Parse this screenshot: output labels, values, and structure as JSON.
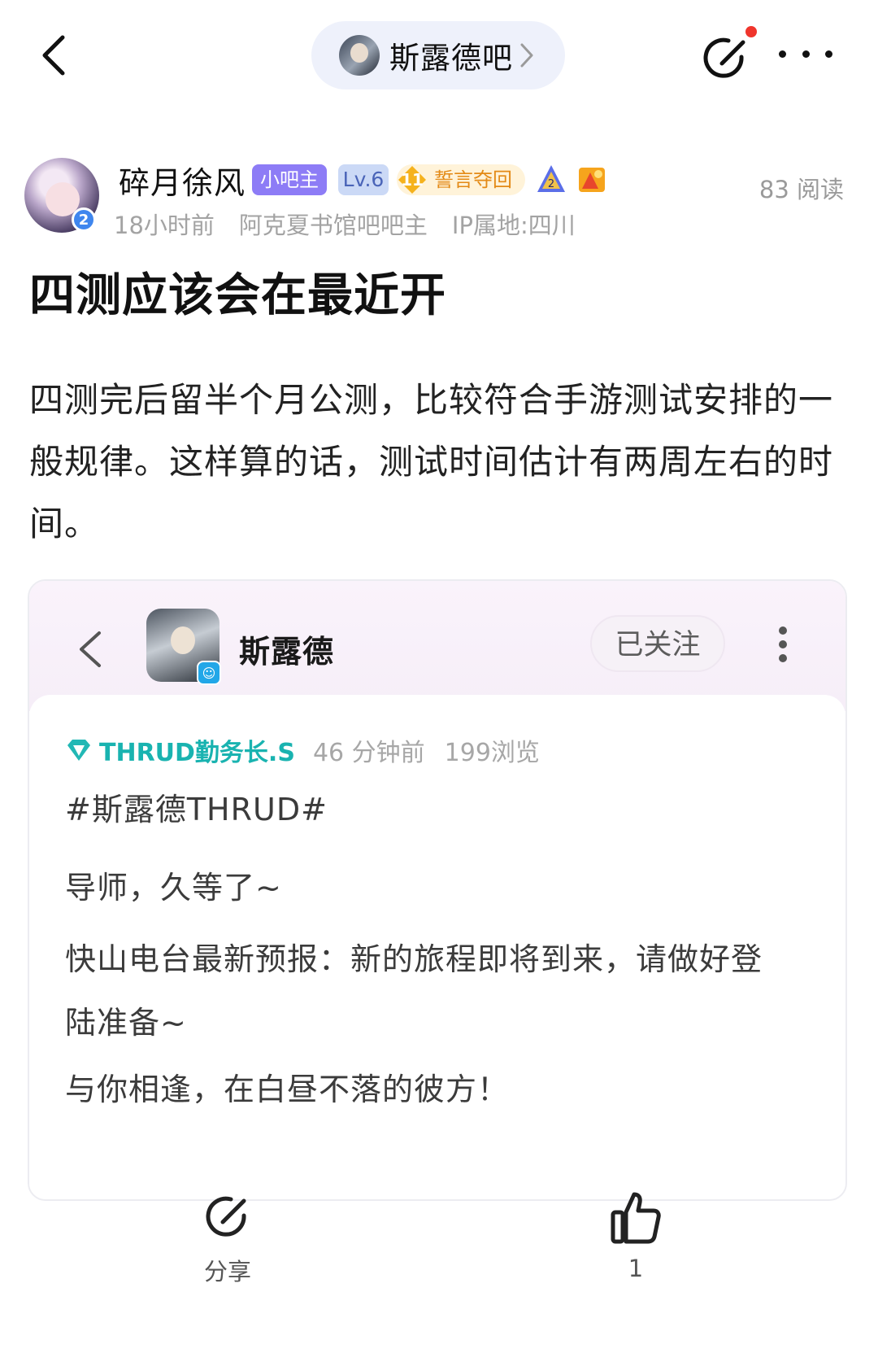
{
  "header": {
    "forum_name": "斯露德吧"
  },
  "author": {
    "name": "碎月徐风",
    "badge_mod": "小吧主",
    "badge_level": "Lv.6",
    "oath_level": "11",
    "oath_label": "誓言夺回",
    "avatar_level": "2",
    "read_count": "83 阅读",
    "time": "18小时前",
    "role": "阿克夏书馆吧吧主",
    "ip": "IP属地:四川"
  },
  "post": {
    "title": "四测应该会在最近开",
    "body": "四测完后留半个月公测，比较符合手游测试安排的一般规律。这样算的话，测试时间估计有两周左右的时间。"
  },
  "embed": {
    "account_name": "斯露德",
    "follow_label": "已关注",
    "author": "THRUD勤务长.S",
    "time": "46 分钟前",
    "views": "199浏览",
    "line1": "#斯露德THRUD#",
    "line2": "导师，久等了~",
    "line3": "快山电台最新预报：新的旅程即将到来，请做好登陆准备~",
    "line4": "与你相逢，在白昼不落的彼方！"
  },
  "actions": {
    "share_label": "分享",
    "like_count": "1"
  },
  "colors": {
    "badge_mod": "#8d7cf6",
    "embed_author": "#19b3b0",
    "notification_dot": "#f0352c",
    "pill_bg": "#eef1fb"
  },
  "icons": [
    "back-icon",
    "chevron-right-icon",
    "compose-icon",
    "more-icon",
    "share-icon",
    "thumbs-up-icon",
    "gem-icon"
  ]
}
